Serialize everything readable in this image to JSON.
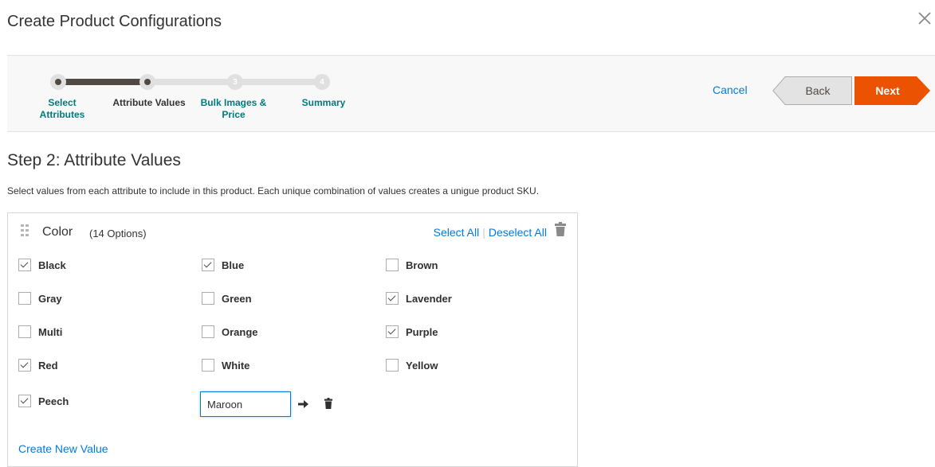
{
  "modal": {
    "title": "Create Product Configurations",
    "close_icon": "close-icon"
  },
  "steps": {
    "items": [
      {
        "number": "",
        "label": "Select Attributes",
        "state": "done"
      },
      {
        "number": "",
        "label": "Attribute Values",
        "state": "current"
      },
      {
        "number": "3",
        "label": "Bulk Images & Price",
        "state": "pending"
      },
      {
        "number": "4",
        "label": "Summary",
        "state": "pending"
      }
    ],
    "progress_fraction": 0.34
  },
  "actions": {
    "cancel_label": "Cancel",
    "back_label": "Back",
    "next_label": "Next"
  },
  "step_content": {
    "heading": "Step 2: Attribute Values",
    "description": "Select values from each attribute to include in this product. Each unique combination of values creates a unigue product SKU."
  },
  "attribute": {
    "name": "Color",
    "count_label": "(14 Options)",
    "select_all": "Select All",
    "deselect_all": "Deselect All",
    "options": [
      {
        "label": "Black",
        "checked": true
      },
      {
        "label": "Blue",
        "checked": true
      },
      {
        "label": "Brown",
        "checked": false
      },
      {
        "label": "Gray",
        "checked": false
      },
      {
        "label": "Green",
        "checked": false
      },
      {
        "label": "Lavender",
        "checked": true
      },
      {
        "label": "Multi",
        "checked": false
      },
      {
        "label": "Orange",
        "checked": false
      },
      {
        "label": "Purple",
        "checked": true
      },
      {
        "label": "Red",
        "checked": true
      },
      {
        "label": "White",
        "checked": false
      },
      {
        "label": "Yellow",
        "checked": false
      },
      {
        "label": "Peech",
        "checked": true
      }
    ],
    "new_value_input": "Maroon",
    "create_new_label": "Create New Value"
  },
  "colors": {
    "accent_link": "#007bdb",
    "next_button": "#eb5202",
    "progress_done": "#514943",
    "step_link": "#007b7f"
  }
}
